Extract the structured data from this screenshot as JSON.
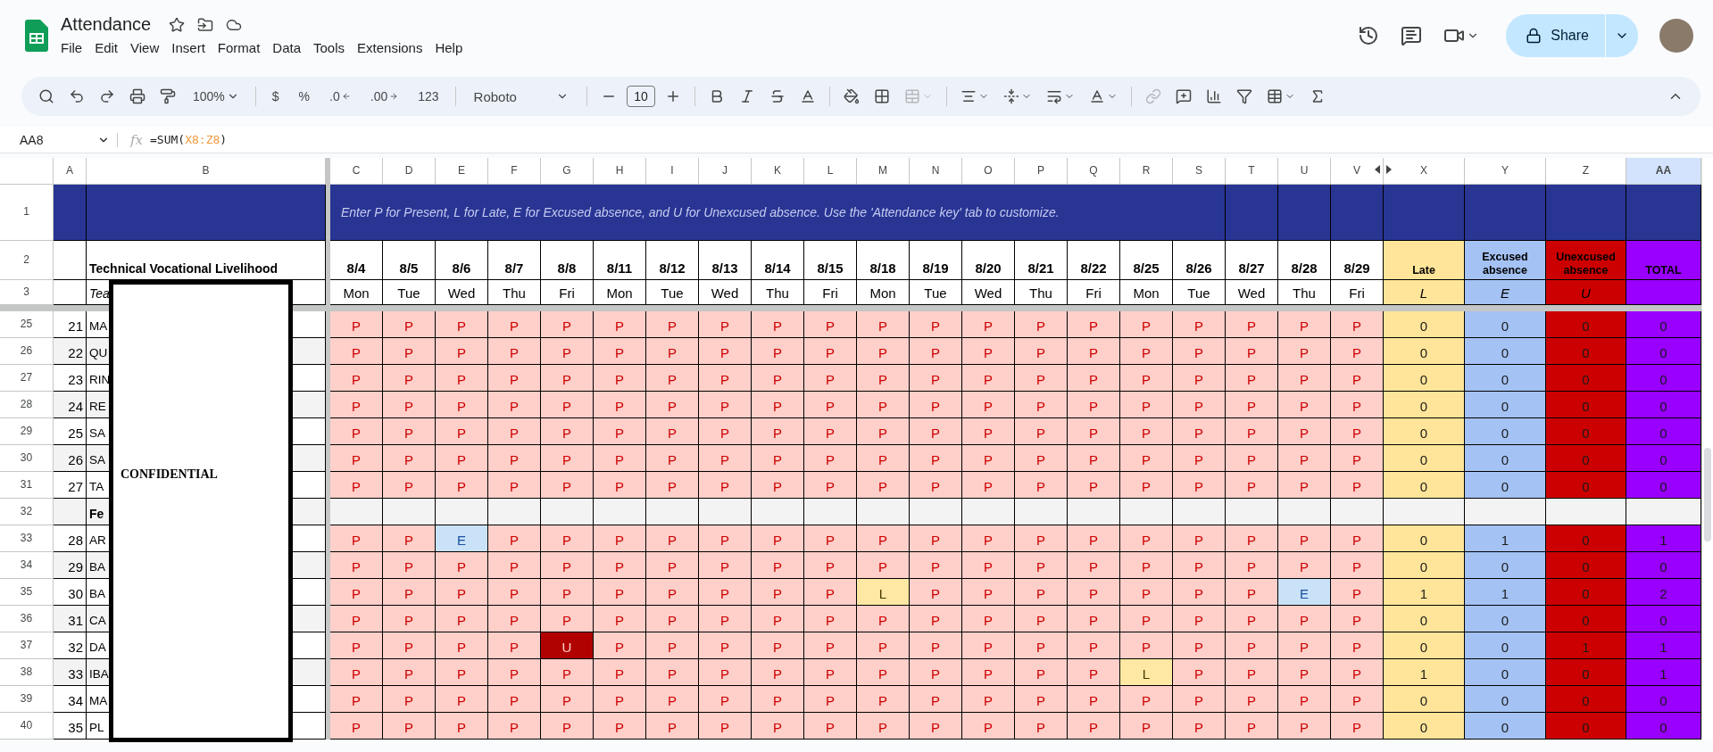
{
  "app": {
    "title": "Attendance",
    "menus": [
      "File",
      "Edit",
      "View",
      "Insert",
      "Format",
      "Data",
      "Tools",
      "Extensions",
      "Help"
    ],
    "share": "Share"
  },
  "toolbar": {
    "zoom": "100%",
    "currency": "$",
    "percent": "%",
    "decrease_decimals": ".0",
    "increase_decimals": ".00",
    "number_format": "123",
    "font": "Roboto",
    "font_size": "10"
  },
  "formula_bar": {
    "cell_ref": "AA8",
    "function_label": "fx",
    "formula_start": "=SUM(",
    "formula_range": "X8:Z8",
    "formula_end": ")"
  },
  "sheet": {
    "columns": [
      {
        "letter": "A",
        "selected": false
      },
      {
        "letter": "B",
        "selected": false
      },
      {
        "letter": "C",
        "selected": false
      },
      {
        "letter": "D",
        "selected": false
      },
      {
        "letter": "E",
        "selected": false
      },
      {
        "letter": "F",
        "selected": false
      },
      {
        "letter": "G",
        "selected": false
      },
      {
        "letter": "H",
        "selected": false
      },
      {
        "letter": "I",
        "selected": false
      },
      {
        "letter": "J",
        "selected": false
      },
      {
        "letter": "K",
        "selected": false
      },
      {
        "letter": "L",
        "selected": false
      },
      {
        "letter": "M",
        "selected": false
      },
      {
        "letter": "N",
        "selected": false
      },
      {
        "letter": "O",
        "selected": false
      },
      {
        "letter": "P",
        "selected": false
      },
      {
        "letter": "Q",
        "selected": false
      },
      {
        "letter": "R",
        "selected": false
      },
      {
        "letter": "S",
        "selected": false
      },
      {
        "letter": "T",
        "selected": false
      },
      {
        "letter": "U",
        "selected": false
      },
      {
        "letter": "V",
        "selected": false,
        "hidden_next": true
      },
      {
        "letter": "X",
        "selected": false,
        "hidden_prev": true
      },
      {
        "letter": "Y",
        "selected": false
      },
      {
        "letter": "Z",
        "selected": false
      },
      {
        "letter": "AA",
        "selected": true
      }
    ],
    "header_rows": [
      "1",
      "2",
      "3"
    ],
    "instruction": "Enter P for Present, L for Late, E for Excused absence, and U for Unexcused absence. Use the 'Attendance key' tab to customize.",
    "course": "Technical Vocational Livelihood",
    "teacher_label": "Tea",
    "dates": [
      {
        "date": "8/4",
        "day": "Mon"
      },
      {
        "date": "8/5",
        "day": "Tue"
      },
      {
        "date": "8/6",
        "day": "Wed"
      },
      {
        "date": "8/7",
        "day": "Thu"
      },
      {
        "date": "8/8",
        "day": "Fri"
      },
      {
        "date": "8/11",
        "day": "Mon"
      },
      {
        "date": "8/12",
        "day": "Tue"
      },
      {
        "date": "8/13",
        "day": "Wed"
      },
      {
        "date": "8/14",
        "day": "Thu"
      },
      {
        "date": "8/15",
        "day": "Fri"
      },
      {
        "date": "8/18",
        "day": "Mon"
      },
      {
        "date": "8/19",
        "day": "Tue"
      },
      {
        "date": "8/20",
        "day": "Wed"
      },
      {
        "date": "8/21",
        "day": "Thu"
      },
      {
        "date": "8/22",
        "day": "Fri"
      },
      {
        "date": "8/25",
        "day": "Mon"
      },
      {
        "date": "8/26",
        "day": "Tue"
      },
      {
        "date": "8/27",
        "day": "Wed"
      },
      {
        "date": "8/28",
        "day": "Thu"
      },
      {
        "date": "8/29",
        "day": "Fri"
      }
    ],
    "summary_columns": [
      {
        "title": "Late",
        "code": "L",
        "color": "#ffe599"
      },
      {
        "title": "Excused absence",
        "code": "E",
        "color": "#a4c2f4"
      },
      {
        "title": "Unexcused absence",
        "code": "U",
        "color": "#cc0000"
      },
      {
        "title": "TOTAL",
        "color": "#9900ff"
      }
    ],
    "rows": [
      {
        "row": "25",
        "kind": "student",
        "no": "21",
        "name": "MA",
        "banded": false,
        "totals": [
          "0",
          "0",
          "0",
          "0"
        ],
        "marks": [
          {
            "mark": "P",
            "kind": "present"
          },
          {
            "mark": "P",
            "kind": "present"
          },
          {
            "mark": "P",
            "kind": "present"
          },
          {
            "mark": "P",
            "kind": "present"
          },
          {
            "mark": "P",
            "kind": "present"
          },
          {
            "mark": "P",
            "kind": "present"
          },
          {
            "mark": "P",
            "kind": "present"
          },
          {
            "mark": "P",
            "kind": "present"
          },
          {
            "mark": "P",
            "kind": "present"
          },
          {
            "mark": "P",
            "kind": "present"
          },
          {
            "mark": "P",
            "kind": "present"
          },
          {
            "mark": "P",
            "kind": "present"
          },
          {
            "mark": "P",
            "kind": "present"
          },
          {
            "mark": "P",
            "kind": "present"
          },
          {
            "mark": "P",
            "kind": "present"
          },
          {
            "mark": "P",
            "kind": "present"
          },
          {
            "mark": "P",
            "kind": "present"
          },
          {
            "mark": "P",
            "kind": "present"
          },
          {
            "mark": "P",
            "kind": "present"
          },
          {
            "mark": "P",
            "kind": "present"
          }
        ]
      },
      {
        "row": "26",
        "kind": "student",
        "no": "22",
        "name": "QU",
        "banded": true,
        "totals": [
          "0",
          "0",
          "0",
          "0"
        ],
        "marks": [
          {
            "mark": "P",
            "kind": "present"
          },
          {
            "mark": "P",
            "kind": "present"
          },
          {
            "mark": "P",
            "kind": "present"
          },
          {
            "mark": "P",
            "kind": "present"
          },
          {
            "mark": "P",
            "kind": "present"
          },
          {
            "mark": "P",
            "kind": "present"
          },
          {
            "mark": "P",
            "kind": "present"
          },
          {
            "mark": "P",
            "kind": "present"
          },
          {
            "mark": "P",
            "kind": "present"
          },
          {
            "mark": "P",
            "kind": "present"
          },
          {
            "mark": "P",
            "kind": "present"
          },
          {
            "mark": "P",
            "kind": "present"
          },
          {
            "mark": "P",
            "kind": "present"
          },
          {
            "mark": "P",
            "kind": "present"
          },
          {
            "mark": "P",
            "kind": "present"
          },
          {
            "mark": "P",
            "kind": "present"
          },
          {
            "mark": "P",
            "kind": "present"
          },
          {
            "mark": "P",
            "kind": "present"
          },
          {
            "mark": "P",
            "kind": "present"
          },
          {
            "mark": "P",
            "kind": "present"
          }
        ]
      },
      {
        "row": "27",
        "kind": "student",
        "no": "23",
        "name": "RIN",
        "banded": false,
        "totals": [
          "0",
          "0",
          "0",
          "0"
        ],
        "marks": [
          {
            "mark": "P",
            "kind": "present"
          },
          {
            "mark": "P",
            "kind": "present"
          },
          {
            "mark": "P",
            "kind": "present"
          },
          {
            "mark": "P",
            "kind": "present"
          },
          {
            "mark": "P",
            "kind": "present"
          },
          {
            "mark": "P",
            "kind": "present"
          },
          {
            "mark": "P",
            "kind": "present"
          },
          {
            "mark": "P",
            "kind": "present"
          },
          {
            "mark": "P",
            "kind": "present"
          },
          {
            "mark": "P",
            "kind": "present"
          },
          {
            "mark": "P",
            "kind": "present"
          },
          {
            "mark": "P",
            "kind": "present"
          },
          {
            "mark": "P",
            "kind": "present"
          },
          {
            "mark": "P",
            "kind": "present"
          },
          {
            "mark": "P",
            "kind": "present"
          },
          {
            "mark": "P",
            "kind": "present"
          },
          {
            "mark": "P",
            "kind": "present"
          },
          {
            "mark": "P",
            "kind": "present"
          },
          {
            "mark": "P",
            "kind": "present"
          },
          {
            "mark": "P",
            "kind": "present"
          }
        ]
      },
      {
        "row": "28",
        "kind": "student",
        "no": "24",
        "name": "RE",
        "banded": true,
        "totals": [
          "0",
          "0",
          "0",
          "0"
        ],
        "marks": [
          {
            "mark": "P",
            "kind": "present"
          },
          {
            "mark": "P",
            "kind": "present"
          },
          {
            "mark": "P",
            "kind": "present"
          },
          {
            "mark": "P",
            "kind": "present"
          },
          {
            "mark": "P",
            "kind": "present"
          },
          {
            "mark": "P",
            "kind": "present"
          },
          {
            "mark": "P",
            "kind": "present"
          },
          {
            "mark": "P",
            "kind": "present"
          },
          {
            "mark": "P",
            "kind": "present"
          },
          {
            "mark": "P",
            "kind": "present"
          },
          {
            "mark": "P",
            "kind": "present"
          },
          {
            "mark": "P",
            "kind": "present"
          },
          {
            "mark": "P",
            "kind": "present"
          },
          {
            "mark": "P",
            "kind": "present"
          },
          {
            "mark": "P",
            "kind": "present"
          },
          {
            "mark": "P",
            "kind": "present"
          },
          {
            "mark": "P",
            "kind": "present"
          },
          {
            "mark": "P",
            "kind": "present"
          },
          {
            "mark": "P",
            "kind": "present"
          },
          {
            "mark": "P",
            "kind": "present"
          }
        ]
      },
      {
        "row": "29",
        "kind": "student",
        "no": "25",
        "name": "SA",
        "banded": false,
        "totals": [
          "0",
          "0",
          "0",
          "0"
        ],
        "marks": [
          {
            "mark": "P",
            "kind": "present"
          },
          {
            "mark": "P",
            "kind": "present"
          },
          {
            "mark": "P",
            "kind": "present"
          },
          {
            "mark": "P",
            "kind": "present"
          },
          {
            "mark": "P",
            "kind": "present"
          },
          {
            "mark": "P",
            "kind": "present"
          },
          {
            "mark": "P",
            "kind": "present"
          },
          {
            "mark": "P",
            "kind": "present"
          },
          {
            "mark": "P",
            "kind": "present"
          },
          {
            "mark": "P",
            "kind": "present"
          },
          {
            "mark": "P",
            "kind": "present"
          },
          {
            "mark": "P",
            "kind": "present"
          },
          {
            "mark": "P",
            "kind": "present"
          },
          {
            "mark": "P",
            "kind": "present"
          },
          {
            "mark": "P",
            "kind": "present"
          },
          {
            "mark": "P",
            "kind": "present"
          },
          {
            "mark": "P",
            "kind": "present"
          },
          {
            "mark": "P",
            "kind": "present"
          },
          {
            "mark": "P",
            "kind": "present"
          },
          {
            "mark": "P",
            "kind": "present"
          }
        ]
      },
      {
        "row": "30",
        "kind": "student",
        "no": "26",
        "name": "SA",
        "banded": true,
        "totals": [
          "0",
          "0",
          "0",
          "0"
        ],
        "marks": [
          {
            "mark": "P",
            "kind": "present"
          },
          {
            "mark": "P",
            "kind": "present"
          },
          {
            "mark": "P",
            "kind": "present"
          },
          {
            "mark": "P",
            "kind": "present"
          },
          {
            "mark": "P",
            "kind": "present"
          },
          {
            "mark": "P",
            "kind": "present"
          },
          {
            "mark": "P",
            "kind": "present"
          },
          {
            "mark": "P",
            "kind": "present"
          },
          {
            "mark": "P",
            "kind": "present"
          },
          {
            "mark": "P",
            "kind": "present"
          },
          {
            "mark": "P",
            "kind": "present"
          },
          {
            "mark": "P",
            "kind": "present"
          },
          {
            "mark": "P",
            "kind": "present"
          },
          {
            "mark": "P",
            "kind": "present"
          },
          {
            "mark": "P",
            "kind": "present"
          },
          {
            "mark": "P",
            "kind": "present"
          },
          {
            "mark": "P",
            "kind": "present"
          },
          {
            "mark": "P",
            "kind": "present"
          },
          {
            "mark": "P",
            "kind": "present"
          },
          {
            "mark": "P",
            "kind": "present"
          }
        ]
      },
      {
        "row": "31",
        "kind": "student",
        "no": "27",
        "name": "TA",
        "banded": false,
        "totals": [
          "0",
          "0",
          "0",
          "0"
        ],
        "marks": [
          {
            "mark": "P",
            "kind": "present"
          },
          {
            "mark": "P",
            "kind": "present"
          },
          {
            "mark": "P",
            "kind": "present"
          },
          {
            "mark": "P",
            "kind": "present"
          },
          {
            "mark": "P",
            "kind": "present"
          },
          {
            "mark": "P",
            "kind": "present"
          },
          {
            "mark": "P",
            "kind": "present"
          },
          {
            "mark": "P",
            "kind": "present"
          },
          {
            "mark": "P",
            "kind": "present"
          },
          {
            "mark": "P",
            "kind": "present"
          },
          {
            "mark": "P",
            "kind": "present"
          },
          {
            "mark": "P",
            "kind": "present"
          },
          {
            "mark": "P",
            "kind": "present"
          },
          {
            "mark": "P",
            "kind": "present"
          },
          {
            "mark": "P",
            "kind": "present"
          },
          {
            "mark": "P",
            "kind": "present"
          },
          {
            "mark": "P",
            "kind": "present"
          },
          {
            "mark": "P",
            "kind": "present"
          },
          {
            "mark": "P",
            "kind": "present"
          },
          {
            "mark": "P",
            "kind": "present"
          }
        ]
      },
      {
        "row": "32",
        "kind": "group",
        "name": "Fe"
      },
      {
        "row": "33",
        "kind": "student",
        "no": "28",
        "name": "AR",
        "banded": false,
        "totals": [
          "0",
          "1",
          "0",
          "1"
        ],
        "marks": [
          {
            "mark": "P",
            "kind": "present"
          },
          {
            "mark": "P",
            "kind": "present"
          },
          {
            "mark": "E",
            "kind": "excused"
          },
          {
            "mark": "P",
            "kind": "present"
          },
          {
            "mark": "P",
            "kind": "present"
          },
          {
            "mark": "P",
            "kind": "present"
          },
          {
            "mark": "P",
            "kind": "present"
          },
          {
            "mark": "P",
            "kind": "present"
          },
          {
            "mark": "P",
            "kind": "present"
          },
          {
            "mark": "P",
            "kind": "present"
          },
          {
            "mark": "P",
            "kind": "present"
          },
          {
            "mark": "P",
            "kind": "present"
          },
          {
            "mark": "P",
            "kind": "present"
          },
          {
            "mark": "P",
            "kind": "present"
          },
          {
            "mark": "P",
            "kind": "present"
          },
          {
            "mark": "P",
            "kind": "present"
          },
          {
            "mark": "P",
            "kind": "present"
          },
          {
            "mark": "P",
            "kind": "present"
          },
          {
            "mark": "P",
            "kind": "present"
          },
          {
            "mark": "P",
            "kind": "present"
          }
        ]
      },
      {
        "row": "34",
        "kind": "student",
        "no": "29",
        "name": "BA",
        "banded": true,
        "totals": [
          "0",
          "0",
          "0",
          "0"
        ],
        "marks": [
          {
            "mark": "P",
            "kind": "present"
          },
          {
            "mark": "P",
            "kind": "present"
          },
          {
            "mark": "P",
            "kind": "present"
          },
          {
            "mark": "P",
            "kind": "present"
          },
          {
            "mark": "P",
            "kind": "present"
          },
          {
            "mark": "P",
            "kind": "present"
          },
          {
            "mark": "P",
            "kind": "present"
          },
          {
            "mark": "P",
            "kind": "present"
          },
          {
            "mark": "P",
            "kind": "present"
          },
          {
            "mark": "P",
            "kind": "present"
          },
          {
            "mark": "P",
            "kind": "present"
          },
          {
            "mark": "P",
            "kind": "present"
          },
          {
            "mark": "P",
            "kind": "present"
          },
          {
            "mark": "P",
            "kind": "present"
          },
          {
            "mark": "P",
            "kind": "present"
          },
          {
            "mark": "P",
            "kind": "present"
          },
          {
            "mark": "P",
            "kind": "present"
          },
          {
            "mark": "P",
            "kind": "present"
          },
          {
            "mark": "P",
            "kind": "present"
          },
          {
            "mark": "P",
            "kind": "present"
          }
        ]
      },
      {
        "row": "35",
        "kind": "student",
        "no": "30",
        "name": "BA",
        "banded": false,
        "totals": [
          "1",
          "1",
          "0",
          "2"
        ],
        "marks": [
          {
            "mark": "P",
            "kind": "present"
          },
          {
            "mark": "P",
            "kind": "present"
          },
          {
            "mark": "P",
            "kind": "present"
          },
          {
            "mark": "P",
            "kind": "present"
          },
          {
            "mark": "P",
            "kind": "present"
          },
          {
            "mark": "P",
            "kind": "present"
          },
          {
            "mark": "P",
            "kind": "present"
          },
          {
            "mark": "P",
            "kind": "present"
          },
          {
            "mark": "P",
            "kind": "present"
          },
          {
            "mark": "P",
            "kind": "present"
          },
          {
            "mark": "L",
            "kind": "late"
          },
          {
            "mark": "P",
            "kind": "present"
          },
          {
            "mark": "P",
            "kind": "present"
          },
          {
            "mark": "P",
            "kind": "present"
          },
          {
            "mark": "P",
            "kind": "present"
          },
          {
            "mark": "P",
            "kind": "present"
          },
          {
            "mark": "P",
            "kind": "present"
          },
          {
            "mark": "P",
            "kind": "present"
          },
          {
            "mark": "E",
            "kind": "excused"
          },
          {
            "mark": "P",
            "kind": "present"
          }
        ]
      },
      {
        "row": "36",
        "kind": "student",
        "no": "31",
        "name": "CA",
        "banded": true,
        "totals": [
          "0",
          "0",
          "0",
          "0"
        ],
        "marks": [
          {
            "mark": "P",
            "kind": "present"
          },
          {
            "mark": "P",
            "kind": "present"
          },
          {
            "mark": "P",
            "kind": "present"
          },
          {
            "mark": "P",
            "kind": "present"
          },
          {
            "mark": "P",
            "kind": "present"
          },
          {
            "mark": "P",
            "kind": "present"
          },
          {
            "mark": "P",
            "kind": "present"
          },
          {
            "mark": "P",
            "kind": "present"
          },
          {
            "mark": "P",
            "kind": "present"
          },
          {
            "mark": "P",
            "kind": "present"
          },
          {
            "mark": "P",
            "kind": "present"
          },
          {
            "mark": "P",
            "kind": "present"
          },
          {
            "mark": "P",
            "kind": "present"
          },
          {
            "mark": "P",
            "kind": "present"
          },
          {
            "mark": "P",
            "kind": "present"
          },
          {
            "mark": "P",
            "kind": "present"
          },
          {
            "mark": "P",
            "kind": "present"
          },
          {
            "mark": "P",
            "kind": "present"
          },
          {
            "mark": "P",
            "kind": "present"
          },
          {
            "mark": "P",
            "kind": "present"
          }
        ]
      },
      {
        "row": "37",
        "kind": "student",
        "no": "32",
        "name": "DA",
        "banded": false,
        "totals": [
          "0",
          "0",
          "1",
          "1"
        ],
        "marks": [
          {
            "mark": "P",
            "kind": "present"
          },
          {
            "mark": "P",
            "kind": "present"
          },
          {
            "mark": "P",
            "kind": "present"
          },
          {
            "mark": "P",
            "kind": "present"
          },
          {
            "mark": "U",
            "kind": "unexcused"
          },
          {
            "mark": "P",
            "kind": "present"
          },
          {
            "mark": "P",
            "kind": "present"
          },
          {
            "mark": "P",
            "kind": "present"
          },
          {
            "mark": "P",
            "kind": "present"
          },
          {
            "mark": "P",
            "kind": "present"
          },
          {
            "mark": "P",
            "kind": "present"
          },
          {
            "mark": "P",
            "kind": "present"
          },
          {
            "mark": "P",
            "kind": "present"
          },
          {
            "mark": "P",
            "kind": "present"
          },
          {
            "mark": "P",
            "kind": "present"
          },
          {
            "mark": "P",
            "kind": "present"
          },
          {
            "mark": "P",
            "kind": "present"
          },
          {
            "mark": "P",
            "kind": "present"
          },
          {
            "mark": "P",
            "kind": "present"
          },
          {
            "mark": "P",
            "kind": "present"
          }
        ]
      },
      {
        "row": "38",
        "kind": "student",
        "no": "33",
        "name": "IBA",
        "banded": true,
        "totals": [
          "1",
          "0",
          "0",
          "1"
        ],
        "marks": [
          {
            "mark": "P",
            "kind": "present"
          },
          {
            "mark": "P",
            "kind": "present"
          },
          {
            "mark": "P",
            "kind": "present"
          },
          {
            "mark": "P",
            "kind": "present"
          },
          {
            "mark": "P",
            "kind": "present"
          },
          {
            "mark": "P",
            "kind": "present"
          },
          {
            "mark": "P",
            "kind": "present"
          },
          {
            "mark": "P",
            "kind": "present"
          },
          {
            "mark": "P",
            "kind": "present"
          },
          {
            "mark": "P",
            "kind": "present"
          },
          {
            "mark": "P",
            "kind": "present"
          },
          {
            "mark": "P",
            "kind": "present"
          },
          {
            "mark": "P",
            "kind": "present"
          },
          {
            "mark": "P",
            "kind": "present"
          },
          {
            "mark": "P",
            "kind": "present"
          },
          {
            "mark": "L",
            "kind": "late"
          },
          {
            "mark": "P",
            "kind": "present"
          },
          {
            "mark": "P",
            "kind": "present"
          },
          {
            "mark": "P",
            "kind": "present"
          },
          {
            "mark": "P",
            "kind": "present"
          }
        ]
      },
      {
        "row": "39",
        "kind": "student",
        "no": "34",
        "name": "MA",
        "banded": false,
        "totals": [
          "0",
          "0",
          "0",
          "0"
        ],
        "marks": [
          {
            "mark": "P",
            "kind": "present"
          },
          {
            "mark": "P",
            "kind": "present"
          },
          {
            "mark": "P",
            "kind": "present"
          },
          {
            "mark": "P",
            "kind": "present"
          },
          {
            "mark": "P",
            "kind": "present"
          },
          {
            "mark": "P",
            "kind": "present"
          },
          {
            "mark": "P",
            "kind": "present"
          },
          {
            "mark": "P",
            "kind": "present"
          },
          {
            "mark": "P",
            "kind": "present"
          },
          {
            "mark": "P",
            "kind": "present"
          },
          {
            "mark": "P",
            "kind": "present"
          },
          {
            "mark": "P",
            "kind": "present"
          },
          {
            "mark": "P",
            "kind": "present"
          },
          {
            "mark": "P",
            "kind": "present"
          },
          {
            "mark": "P",
            "kind": "present"
          },
          {
            "mark": "P",
            "kind": "present"
          },
          {
            "mark": "P",
            "kind": "present"
          },
          {
            "mark": "P",
            "kind": "present"
          },
          {
            "mark": "P",
            "kind": "present"
          },
          {
            "mark": "P",
            "kind": "present"
          }
        ]
      },
      {
        "row": "40",
        "kind": "student",
        "no": "35",
        "name": "PL",
        "banded": false,
        "totals": [
          "0",
          "0",
          "0",
          "0"
        ],
        "marks": [
          {
            "mark": "P",
            "kind": "present"
          },
          {
            "mark": "P",
            "kind": "present"
          },
          {
            "mark": "P",
            "kind": "present"
          },
          {
            "mark": "P",
            "kind": "present"
          },
          {
            "mark": "P",
            "kind": "present"
          },
          {
            "mark": "P",
            "kind": "present"
          },
          {
            "mark": "P",
            "kind": "present"
          },
          {
            "mark": "P",
            "kind": "present"
          },
          {
            "mark": "P",
            "kind": "present"
          },
          {
            "mark": "P",
            "kind": "present"
          },
          {
            "mark": "P",
            "kind": "present"
          },
          {
            "mark": "P",
            "kind": "present"
          },
          {
            "mark": "P",
            "kind": "present"
          },
          {
            "mark": "P",
            "kind": "present"
          },
          {
            "mark": "P",
            "kind": "present"
          },
          {
            "mark": "P",
            "kind": "present"
          },
          {
            "mark": "P",
            "kind": "present"
          },
          {
            "mark": "P",
            "kind": "present"
          },
          {
            "mark": "P",
            "kind": "present"
          },
          {
            "mark": "P",
            "kind": "present"
          }
        ]
      }
    ],
    "redaction": {
      "label": "CONFIDENTIAL"
    }
  }
}
